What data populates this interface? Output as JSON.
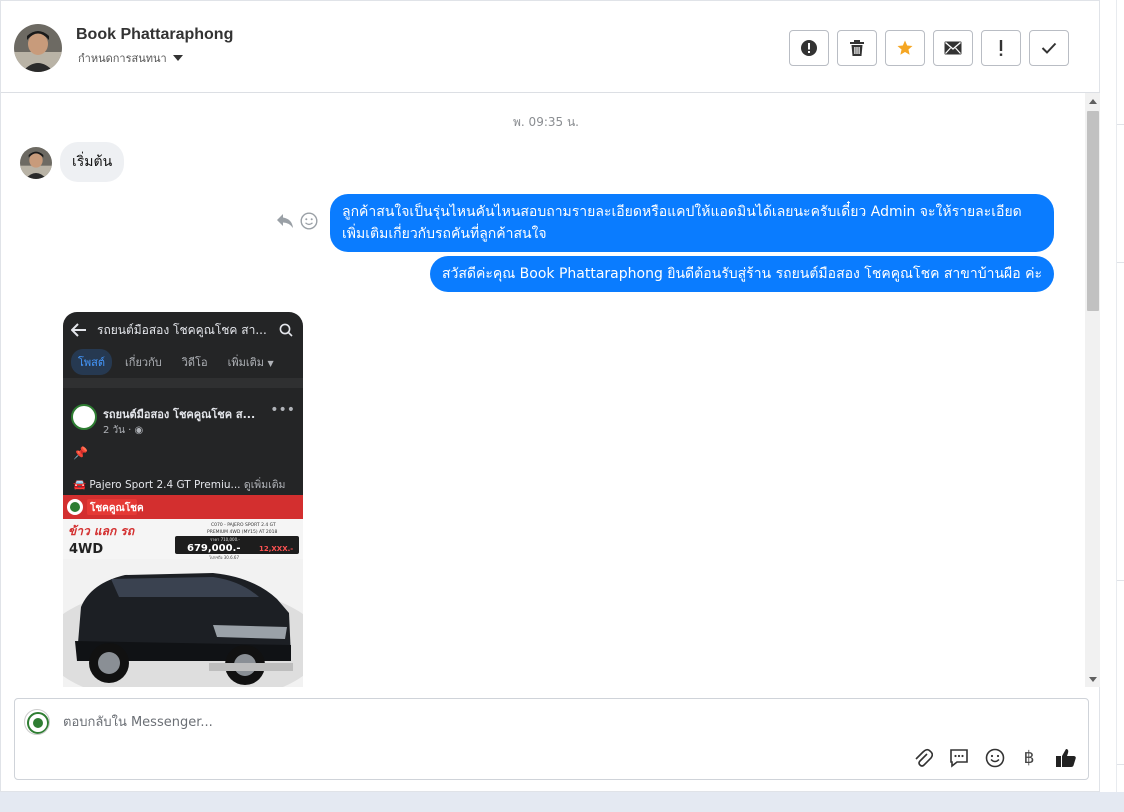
{
  "header": {
    "contact_name": "Book Phattaraphong",
    "assign_label": "กำหนดการสนทนา",
    "buttons": [
      {
        "name": "report",
        "icon": "exclamation-circle-icon"
      },
      {
        "name": "delete",
        "icon": "trash-icon"
      },
      {
        "name": "star",
        "icon": "star-icon",
        "color": "#f5a623"
      },
      {
        "name": "unread",
        "icon": "envelope-icon"
      },
      {
        "name": "important",
        "icon": "exclamation-icon"
      },
      {
        "name": "done",
        "icon": "check-icon"
      }
    ]
  },
  "conversation": {
    "timestamp": "พ. 09:35 น.",
    "messages": [
      {
        "direction": "in",
        "text": "เริ่มต้น"
      },
      {
        "direction": "out",
        "text": "ลูกค้าสนใจเป็นรุ่นไหนคันไหนสอบถามรายละเอียดหรือแคปให้แอดมินได้เลยนะครับเดี๋ยว Admin จะให้รายละเอียดเพิ่มเติมเกี่ยวกับรถคันที่ลูกค้าสนใจ"
      },
      {
        "direction": "out",
        "text": "สวัสดีค่ะคุณ Book Phattaraphong ยินดีต้อนรับสู่ร้าน รถยนต์มือสอง โชคคูณโชค สาขาบ้านผือ ค่ะ"
      }
    ],
    "outgoing_color": "#0a7cff",
    "attachment": {
      "header_title": "รถยนต์มือสอง โชคคูณโชค สา...",
      "tabs": [
        "โพสต์",
        "เกี่ยวกับ",
        "วิดีโอ",
        "เพิ่มเติม"
      ],
      "post_author": "รถยนต์มือสอง โชคคูณโชค ส...",
      "post_meta": "2 วัน ·",
      "post_text": "Pajero Sport 2.4 GT Premiu...",
      "post_more": "ดูเพิ่มเติม",
      "ad": {
        "brand": "โชคคูณโชค",
        "headline": "ข้าว แลก รถ",
        "drive": "4WD",
        "model_line1": "C070 - PAJERO SPORT 2.4 GT",
        "model_line2": "PREMIUM 4WD (MY15) AT 2018",
        "old_price": "ราคา 710,000.-",
        "price": "679,000.-",
        "extra": "12,XXX.-",
        "valid": "โปรฯถึง 30.6.67"
      }
    }
  },
  "composer": {
    "placeholder": "ตอบกลับใน Messenger...",
    "tools": [
      "paperclip-icon",
      "speech-bubble-icon",
      "smiley-icon",
      "baht-icon",
      "thumbs-up-icon"
    ],
    "baht_symbol": "฿"
  }
}
